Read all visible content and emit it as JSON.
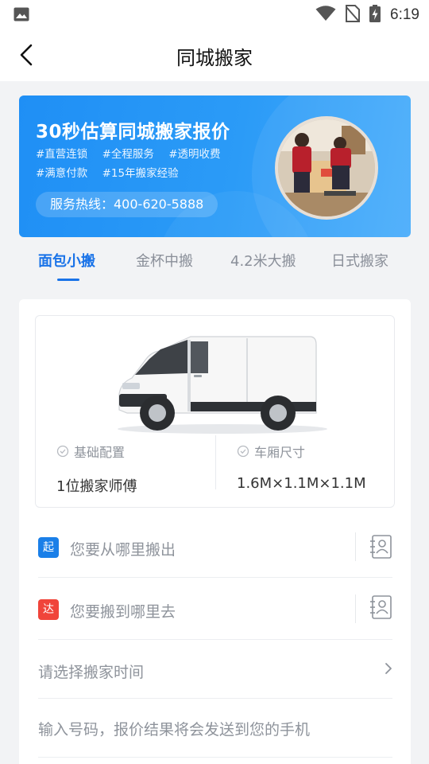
{
  "status_bar": {
    "time": "6:19"
  },
  "nav": {
    "title": "同城搬家"
  },
  "banner": {
    "title": "30秒估算同城搬家报价",
    "tags": [
      "#直营连锁",
      "#全程服务",
      "#透明收费",
      "#满意付款",
      "#15年搬家经验"
    ],
    "hotline": "服务热线：400-620-5888"
  },
  "tabs": [
    {
      "label": "面包小搬",
      "active": true
    },
    {
      "label": "金杯中搬",
      "active": false
    },
    {
      "label": "4.2米大搬",
      "active": false
    },
    {
      "label": "日式搬家",
      "active": false
    }
  ],
  "vehicle": {
    "config_label": "基础配置",
    "config_value": "1位搬家师傅",
    "size_label": "车厢尺寸",
    "size_value": "1.6M×1.1M×1.1M"
  },
  "form": {
    "from_badge": "起",
    "from_placeholder": "您要从哪里搬出",
    "to_badge": "达",
    "to_placeholder": "您要搬到哪里去",
    "time_placeholder": "请选择搬家时间",
    "phone_placeholder": "输入号码，报价结果将会发送到您的手机"
  },
  "colors": {
    "accent": "#1a73e8",
    "from_badge": "#1a7fe8",
    "to_badge": "#f0443a"
  }
}
